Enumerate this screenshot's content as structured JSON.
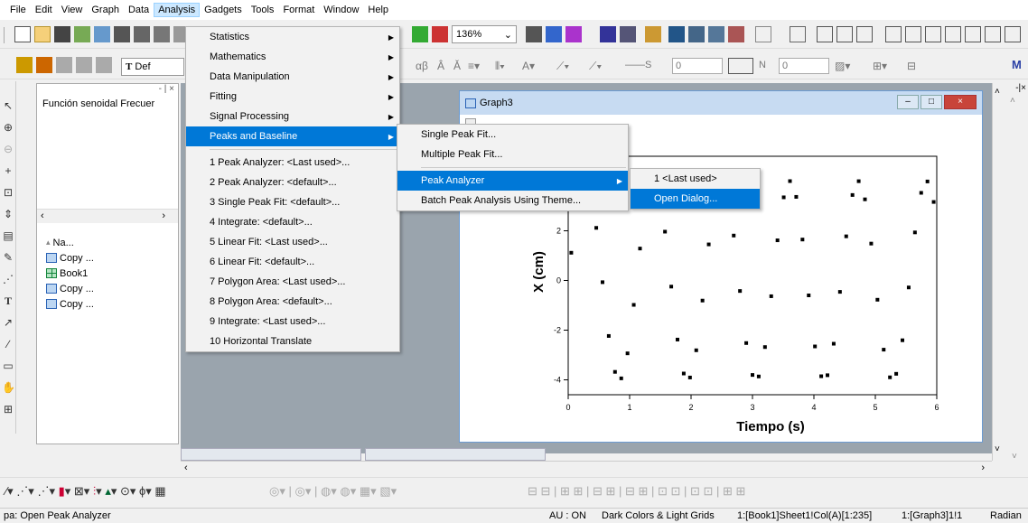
{
  "menubar": [
    "File",
    "Edit",
    "View",
    "Graph",
    "Data",
    "Analysis",
    "Gadgets",
    "Tools",
    "Format",
    "Window",
    "Help"
  ],
  "toolbar": {
    "zoom_value": "136%",
    "font_preview": "Def",
    "greek_label": "αβ",
    "line_width_value": "0",
    "pattern_n_value": "N",
    "size_value": "0"
  },
  "project": {
    "top_text": "Función senoidal Frecuer",
    "column_header": "Na...",
    "items": [
      {
        "icon": "graph-icon",
        "label": "Copy ..."
      },
      {
        "icon": "book-icon",
        "label": "Book1"
      },
      {
        "icon": "graph-icon",
        "label": "Copy ..."
      },
      {
        "icon": "graph-icon",
        "label": "Copy ..."
      }
    ]
  },
  "graph_window": {
    "title": "Graph3"
  },
  "chart_data": {
    "type": "scatter",
    "title": "",
    "xlabel": "Tiempo (s)",
    "ylabel": "X (cm)",
    "xlim": [
      0,
      6
    ],
    "ylim": [
      -4.6,
      5
    ],
    "x_ticks": [
      "0",
      "1",
      "2",
      "3",
      "4",
      "5",
      "6"
    ],
    "y_ticks": [
      "-4",
      "-2",
      "0",
      "2"
    ],
    "series": [
      {
        "name": "",
        "function": "sine",
        "amplitude": 4,
        "frequency_hz": 0.9,
        "x_range": [
          0.05,
          5.95
        ],
        "points": 59
      }
    ]
  },
  "analysis_menu": {
    "items": [
      {
        "label": "Statistics",
        "submenu": true
      },
      {
        "label": "Mathematics",
        "submenu": true
      },
      {
        "label": "Data Manipulation",
        "submenu": true
      },
      {
        "label": "Fitting",
        "submenu": true
      },
      {
        "label": "Signal Processing",
        "submenu": true
      },
      {
        "label": "Peaks and Baseline",
        "submenu": true,
        "highlighted": true
      }
    ],
    "recent": [
      "1 Peak Analyzer: <Last used>...",
      "2 Peak Analyzer: <default>...",
      "3 Single Peak Fit: <default>...",
      "4 Integrate: <default>...",
      "5 Linear Fit: <Last used>...",
      "6 Linear Fit: <default>...",
      "7 Polygon Area: <Last used>...",
      "8 Polygon Area: <default>...",
      "9 Integrate: <Last used>...",
      "10 Horizontal Translate"
    ]
  },
  "peaks_menu": {
    "items": [
      {
        "label": "Single Peak Fit..."
      },
      {
        "label": "Multiple Peak Fit..."
      }
    ],
    "items2": [
      {
        "label": "Peak Analyzer",
        "submenu": true,
        "highlighted": true
      },
      {
        "label": "Batch Peak Analysis Using Theme..."
      }
    ]
  },
  "peak_analyzer_menu": {
    "items": [
      {
        "label": "1 <Last used>"
      },
      {
        "label": "Open Dialog...",
        "highlighted": true
      }
    ]
  },
  "status": {
    "hint": "pa: Open Peak Analyzer",
    "au": "AU : ON",
    "theme": "Dark Colors & Light Grids",
    "cell": "1:[Book1]Sheet1!Col(A)[1:235]",
    "graph": "1:[Graph3]1!1",
    "angle": "Radian"
  },
  "colors": {
    "highlight": "#0078d7",
    "menu_bg": "#f2f2f2",
    "workspace": "#9aa4ad"
  }
}
